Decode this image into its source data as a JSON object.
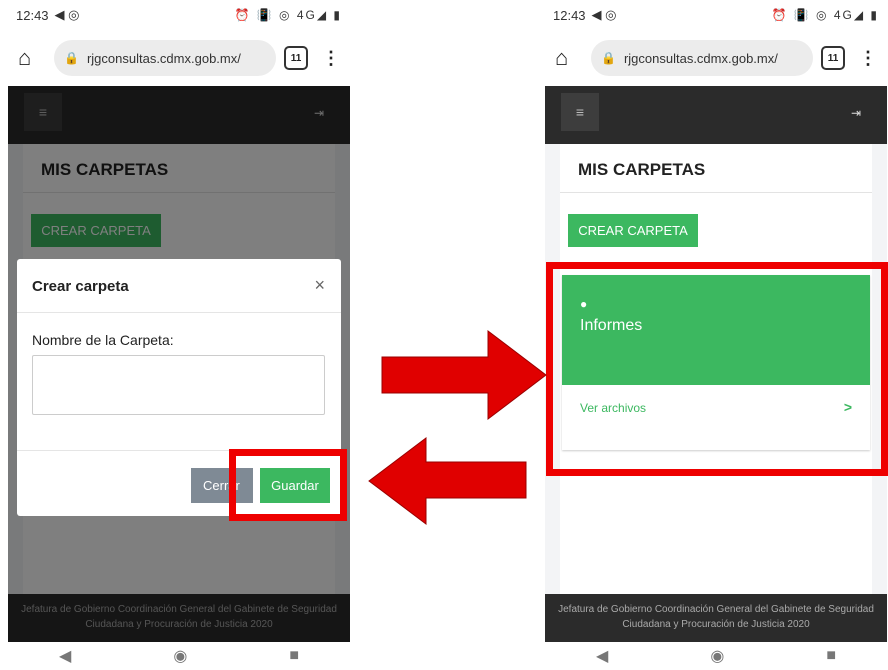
{
  "status": {
    "time": "12:43",
    "left_icons": "◀ ◎",
    "right_icons": "⏰ 📳 ◎ 4G◢ ▮"
  },
  "browser": {
    "url": "rjgconsultas.cdmx.gob.mx/",
    "tab_count": "11"
  },
  "page": {
    "section_title": "MIS CARPETAS",
    "create_button": "CREAR CARPETA",
    "footer": "Jefatura de Gobierno Coordinación General del Gabinete de Seguridad Ciudadana y Procuración de Justicia 2020"
  },
  "modal": {
    "title": "Crear carpeta",
    "close": "×",
    "field_label": "Nombre de la Carpeta:",
    "field_value": "",
    "cancel_label": "Cerrar",
    "save_label": "Guardar"
  },
  "folder": {
    "name": "Informes",
    "link_label": "Ver archivos",
    "chevron": ">"
  },
  "icons": {
    "hamburger": "≡",
    "logout": "⇥"
  },
  "colors": {
    "accent_green": "#3cb860",
    "highlight_red": "#e00000",
    "nav_dark": "#2b2b2b"
  }
}
